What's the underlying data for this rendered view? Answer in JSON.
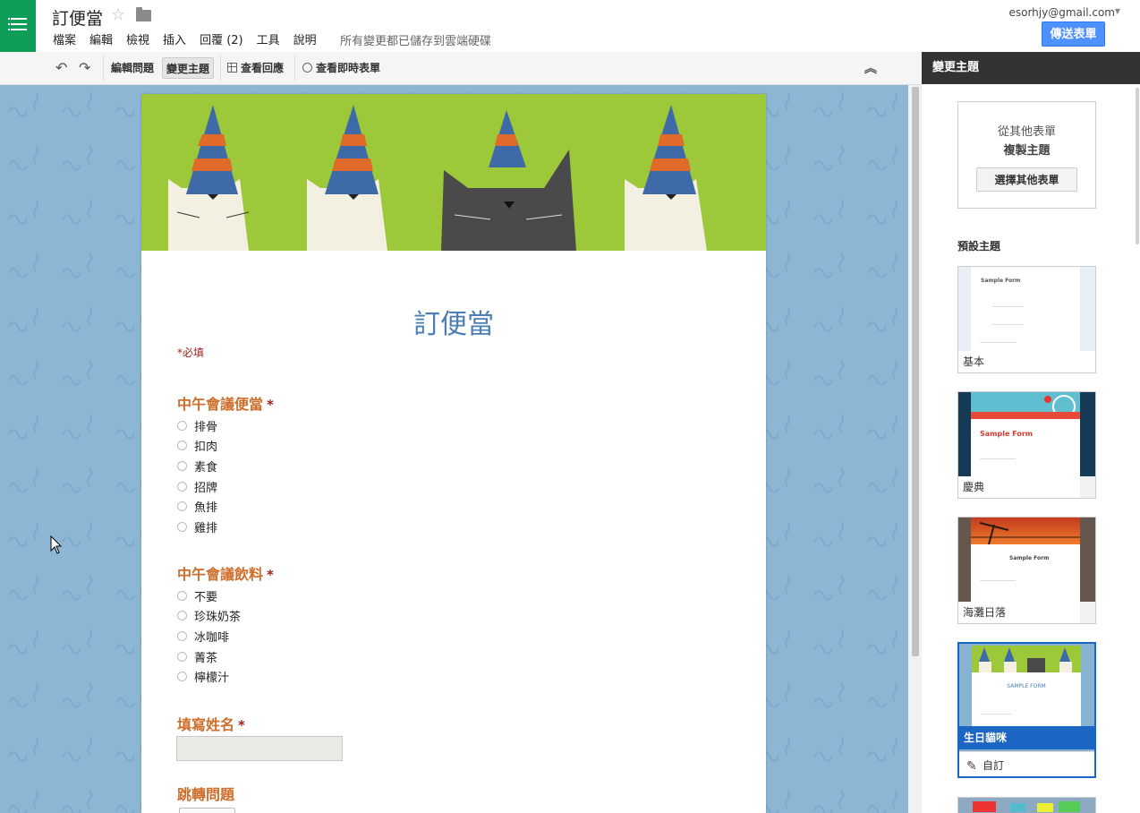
{
  "header": {
    "doc_title": "訂便當",
    "menus": [
      "檔案",
      "編輯",
      "檢視",
      "插入",
      "回覆 (2)",
      "工具",
      "說明"
    ],
    "save_status": "所有變更都已儲存到雲端硬碟",
    "account": "esorhjy@gmail.com",
    "send_button": "傳送表單",
    "icons": {
      "app": "menu-icon",
      "star": "star-icon",
      "folder": "folder-icon",
      "account_menu": "caret-down-icon"
    }
  },
  "toolbar": {
    "edit_questions": "編輯問題",
    "change_theme": "變更主題",
    "view_responses": "查看回應",
    "view_live_form": "查看即時表單",
    "icons": [
      "undo-icon",
      "redo-icon",
      "grid-icon",
      "globe-icon",
      "collapse-icon"
    ]
  },
  "form": {
    "title": "訂便當",
    "required_note": "*必填",
    "questions": [
      {
        "title": "中午會議便當",
        "required_mark": "*",
        "options": [
          "排骨",
          "扣肉",
          "素食",
          "招牌",
          "魚排",
          "雞排"
        ]
      },
      {
        "title": "中午會議飲料",
        "required_mark": "*",
        "options": [
          "不要",
          "珍珠奶茶",
          "冰咖啡",
          "菁茶",
          "檸檬汁"
        ]
      },
      {
        "title": "填寫姓名",
        "required_mark": "*"
      },
      {
        "title": "跳轉問題"
      }
    ]
  },
  "panel": {
    "header": "變更主題",
    "copy_line1": "從其他表單",
    "copy_line2": "複製主題",
    "choose_form_button": "選擇其他表單",
    "preset_label": "預設主題",
    "themes": [
      {
        "name": "基本",
        "sample": "Sample Form",
        "accent": "#555555"
      },
      {
        "name": "慶典",
        "sample": "Sample Form",
        "accent": "#d23b2e"
      },
      {
        "name": "海灘日落",
        "sample": "Sample Form",
        "accent": "#444444"
      },
      {
        "name": "生日貓咪",
        "sample": "SAMPLE FORM",
        "accent": "#4a7eb4",
        "selected": true
      }
    ],
    "customize": "自訂"
  },
  "colors": {
    "app_green": "#0f9d58",
    "send_blue": "#4d90fe",
    "canvas_blue": "#8cb6d4",
    "banner_green": "#9cc83a",
    "question_orange": "#cf6d2a",
    "required_red": "#a0221e",
    "form_title_blue": "#4a7eb4",
    "selected_blue": "#1a66c2"
  }
}
